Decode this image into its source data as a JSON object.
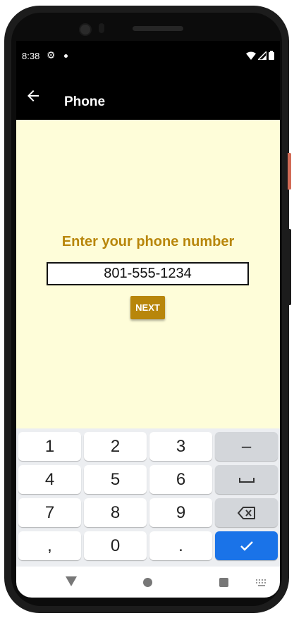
{
  "status_bar": {
    "time": "8:38"
  },
  "app_bar": {
    "title": "Phone"
  },
  "main": {
    "prompt": "Enter your phone number",
    "phone_value": "801-555-1234",
    "next_label": "NEXT"
  },
  "keyboard": {
    "row1": [
      "1",
      "2",
      "3",
      "–"
    ],
    "row2": [
      "4",
      "5",
      "6"
    ],
    "row3": [
      "7",
      "8",
      "9"
    ],
    "row4": [
      ",",
      "0",
      "."
    ]
  },
  "colors": {
    "accent": "#b8860b",
    "content_bg": "#fefdd9",
    "done_key": "#1a73e8"
  },
  "icons": {
    "back": "arrow-left-icon",
    "space": "space-bar-icon",
    "delete": "backspace-icon",
    "done": "checkmark-icon"
  }
}
